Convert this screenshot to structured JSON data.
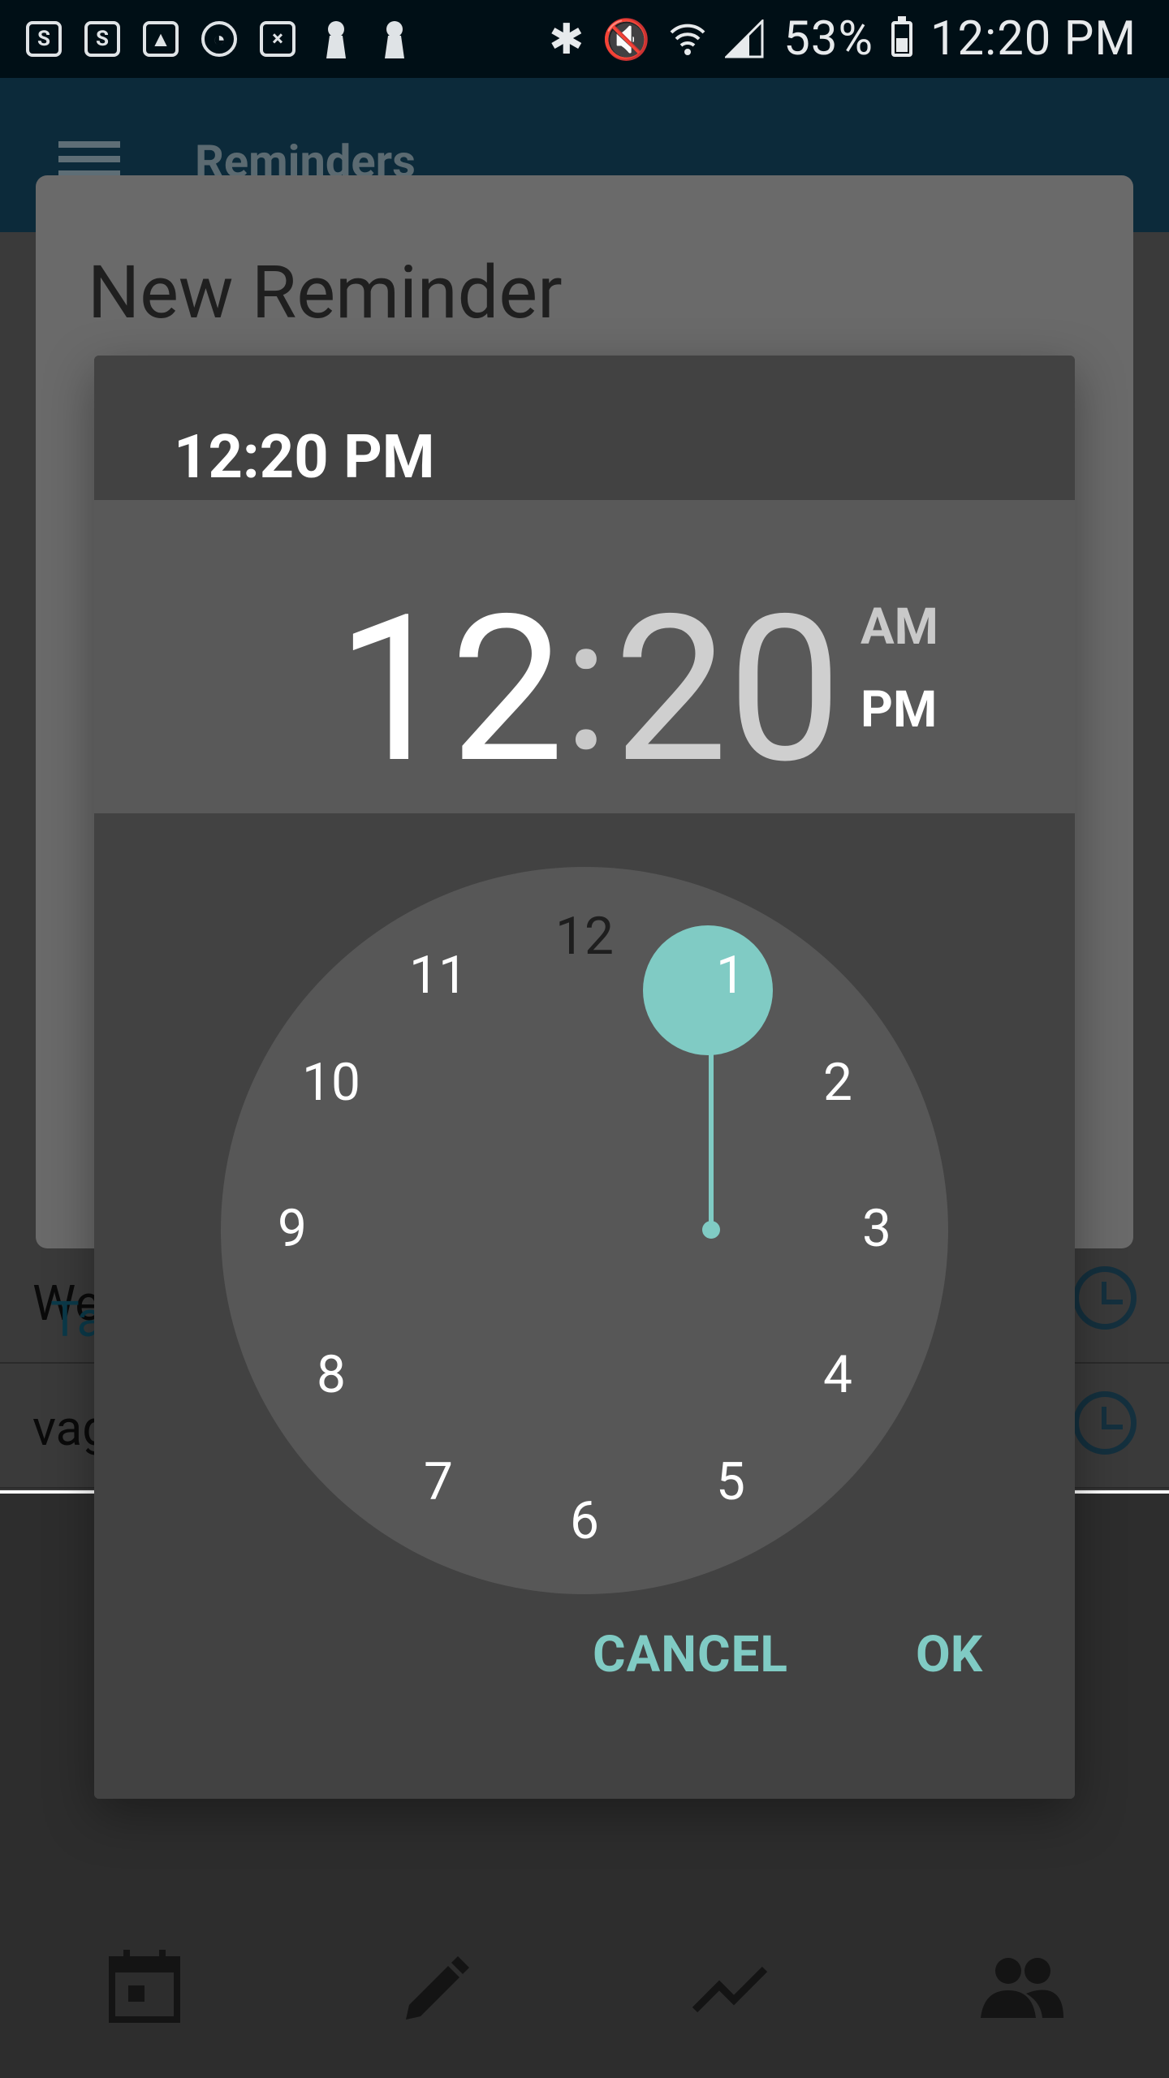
{
  "status_bar": {
    "battery_percent": "53%",
    "time": "12:20 PM",
    "left_icons": [
      "skype-icon",
      "skype-business-icon",
      "gallery-icon",
      "sync-icon",
      "calculator-icon",
      "keyhole-icon",
      "keyhole-icon"
    ],
    "right_icons": [
      "bluetooth-icon",
      "mute-icon",
      "wifi-icon",
      "signal-icon",
      "battery-icon"
    ]
  },
  "app_bar": {
    "title": "Reminders",
    "menu_icon": "hamburger-icon"
  },
  "list": {
    "rows": [
      {
        "text": "We"
      },
      {
        "text": "vag"
      }
    ],
    "link_text": "Ta",
    "row_icon": "alarm-icon"
  },
  "reminder_dialog": {
    "title": "New Reminder"
  },
  "time_picker": {
    "header_time": "12:20 PM",
    "hours": "12",
    "separator": ":",
    "minutes": "20",
    "am_label": "AM",
    "pm_label": "PM",
    "selected_period": "PM",
    "selected_hour": 12,
    "clock_numbers": [
      "12",
      "1",
      "2",
      "3",
      "4",
      "5",
      "6",
      "7",
      "8",
      "9",
      "10",
      "11"
    ],
    "cancel_label": "CANCEL",
    "ok_label": "OK",
    "accent_color": "#80cbc4"
  },
  "bottom_nav": {
    "icons": [
      "calendar-icon",
      "edit-icon",
      "trending-icon",
      "people-icon"
    ]
  }
}
